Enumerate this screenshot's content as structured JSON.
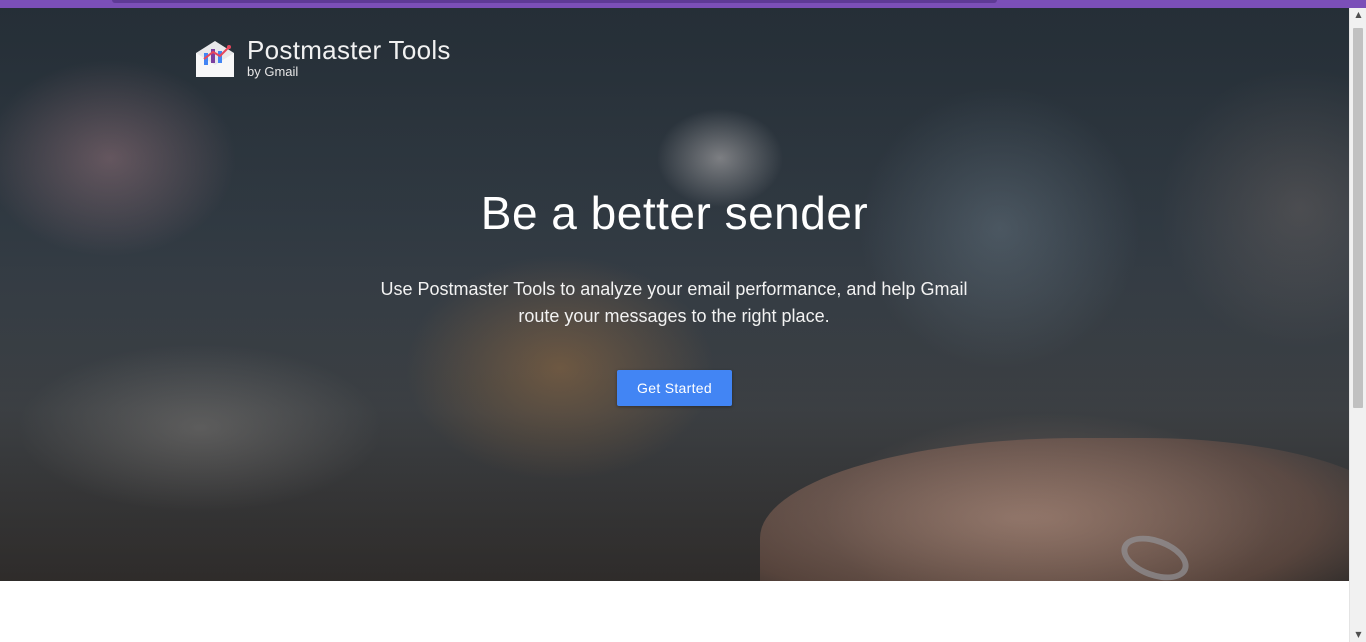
{
  "brand": {
    "title": "Postmaster Tools",
    "subtitle": "by Gmail",
    "logo_icon": "envelope-chart-icon"
  },
  "hero": {
    "headline": "Be a better sender",
    "description": "Use Postmaster Tools to analyze your email performance, and help Gmail route your messages to the right place.",
    "cta_label": "Get Started"
  },
  "colors": {
    "browser_topbar": "#7b4fb8",
    "cta_background": "#4285f4",
    "text_on_hero": "#ffffff"
  },
  "scrollbar": {
    "up_arrow": "▲",
    "down_arrow": "▼"
  }
}
